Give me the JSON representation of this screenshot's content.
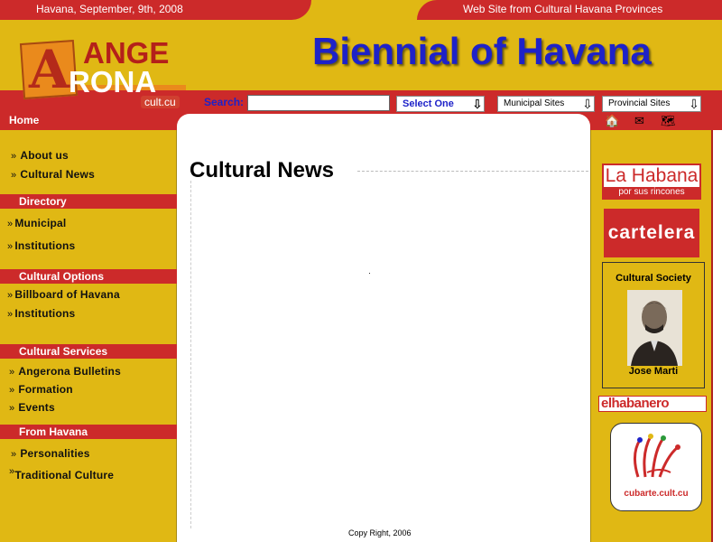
{
  "top_bar": {
    "date_text": "Havana, September, 9th, 2008",
    "site_info": "Web Site from Cultural Havana Provinces"
  },
  "logo": {
    "letter": "A",
    "line1": "ANGE",
    "line2": "RONA",
    "domain": "cult.cu"
  },
  "header": {
    "title": "Biennial of Havana"
  },
  "search": {
    "label": "Search:",
    "value": "",
    "select_label": "Select One",
    "municipal_label": "Municipal Sites",
    "provincial_label": "Provincial Sites"
  },
  "nav": {
    "home": "Home",
    "top_items": [
      {
        "label": "About us"
      },
      {
        "label": "Cultural News"
      }
    ],
    "sections": [
      {
        "title": "Directory",
        "items": [
          {
            "label": "Municipal"
          },
          {
            "label": "Institutions"
          }
        ]
      },
      {
        "title": "Cultural Options",
        "items": [
          {
            "label": "Billboard of Havana"
          },
          {
            "label": "Institutions"
          }
        ]
      },
      {
        "title": "Cultural Services",
        "items": [
          {
            "label": "Angerona Bulletins"
          },
          {
            "label": "Formation"
          },
          {
            "label": "Events"
          }
        ]
      },
      {
        "title": "From Havana",
        "items": [
          {
            "label": "Personalities"
          },
          {
            "label": "Traditional Culture"
          }
        ]
      }
    ]
  },
  "main": {
    "title": "Cultural News",
    "footer": "Copy Right, 2006"
  },
  "right_col": {
    "lahabana_line1": "La Habana",
    "lahabana_line2": "por sus rincones",
    "cartelera": "cartelera",
    "society_title": "Cultural  Society",
    "society_name": "Jose Marti",
    "habanero": "elhabanero",
    "cubarte": "cubarte.cult.cu"
  },
  "colors": {
    "yellow": "#e0b814",
    "red": "#cc2a2a",
    "title_blue": "#1e22c8"
  }
}
